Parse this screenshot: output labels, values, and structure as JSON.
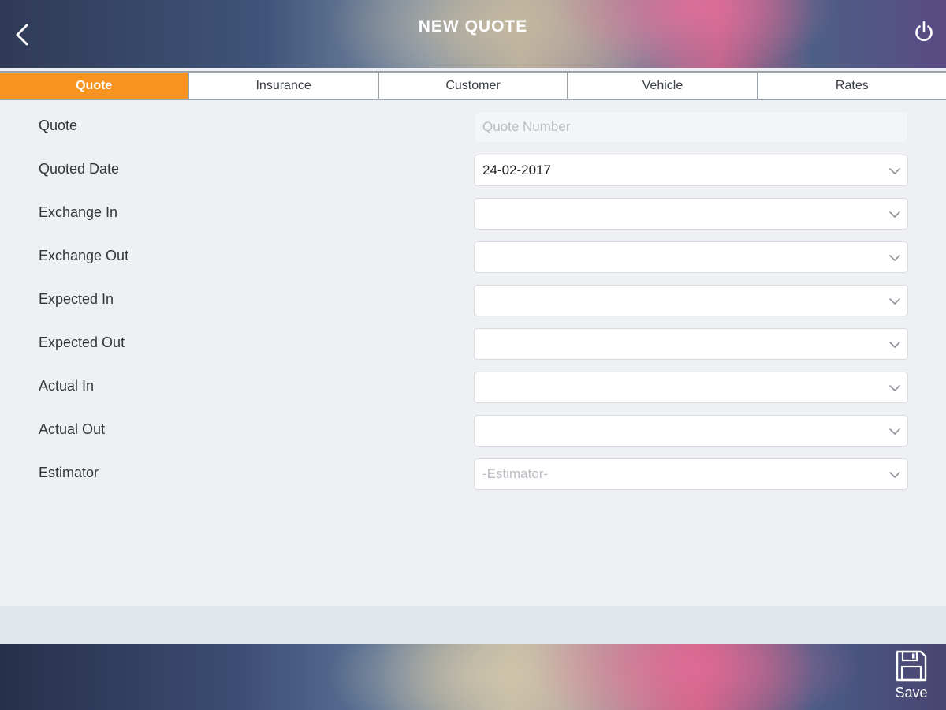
{
  "header": {
    "title": "NEW QUOTE",
    "back_icon": "chevron-left-icon",
    "power_icon": "power-icon"
  },
  "tabs": [
    {
      "label": "Quote",
      "active": true
    },
    {
      "label": "Insurance",
      "active": false
    },
    {
      "label": "Customer",
      "active": false
    },
    {
      "label": "Vehicle",
      "active": false
    },
    {
      "label": "Rates",
      "active": false
    }
  ],
  "form": {
    "quote": {
      "label": "Quote",
      "placeholder": "Quote Number",
      "value": ""
    },
    "quoted_date": {
      "label": "Quoted Date",
      "value": "24-02-2017"
    },
    "exchange_in": {
      "label": "Exchange In",
      "value": ""
    },
    "exchange_out": {
      "label": "Exchange Out",
      "value": ""
    },
    "expected_in": {
      "label": "Expected In",
      "value": ""
    },
    "expected_out": {
      "label": "Expected Out",
      "value": ""
    },
    "actual_in": {
      "label": "Actual In",
      "value": ""
    },
    "actual_out": {
      "label": "Actual Out",
      "value": ""
    },
    "estimator": {
      "label": "Estimator",
      "placeholder": "-Estimator-",
      "value": ""
    }
  },
  "footer": {
    "save_label": "Save",
    "save_icon": "floppy-disk-icon"
  },
  "colors": {
    "accent": "#f7931e",
    "tab_border": "#9aa0a8",
    "background": "#eff0f4"
  }
}
